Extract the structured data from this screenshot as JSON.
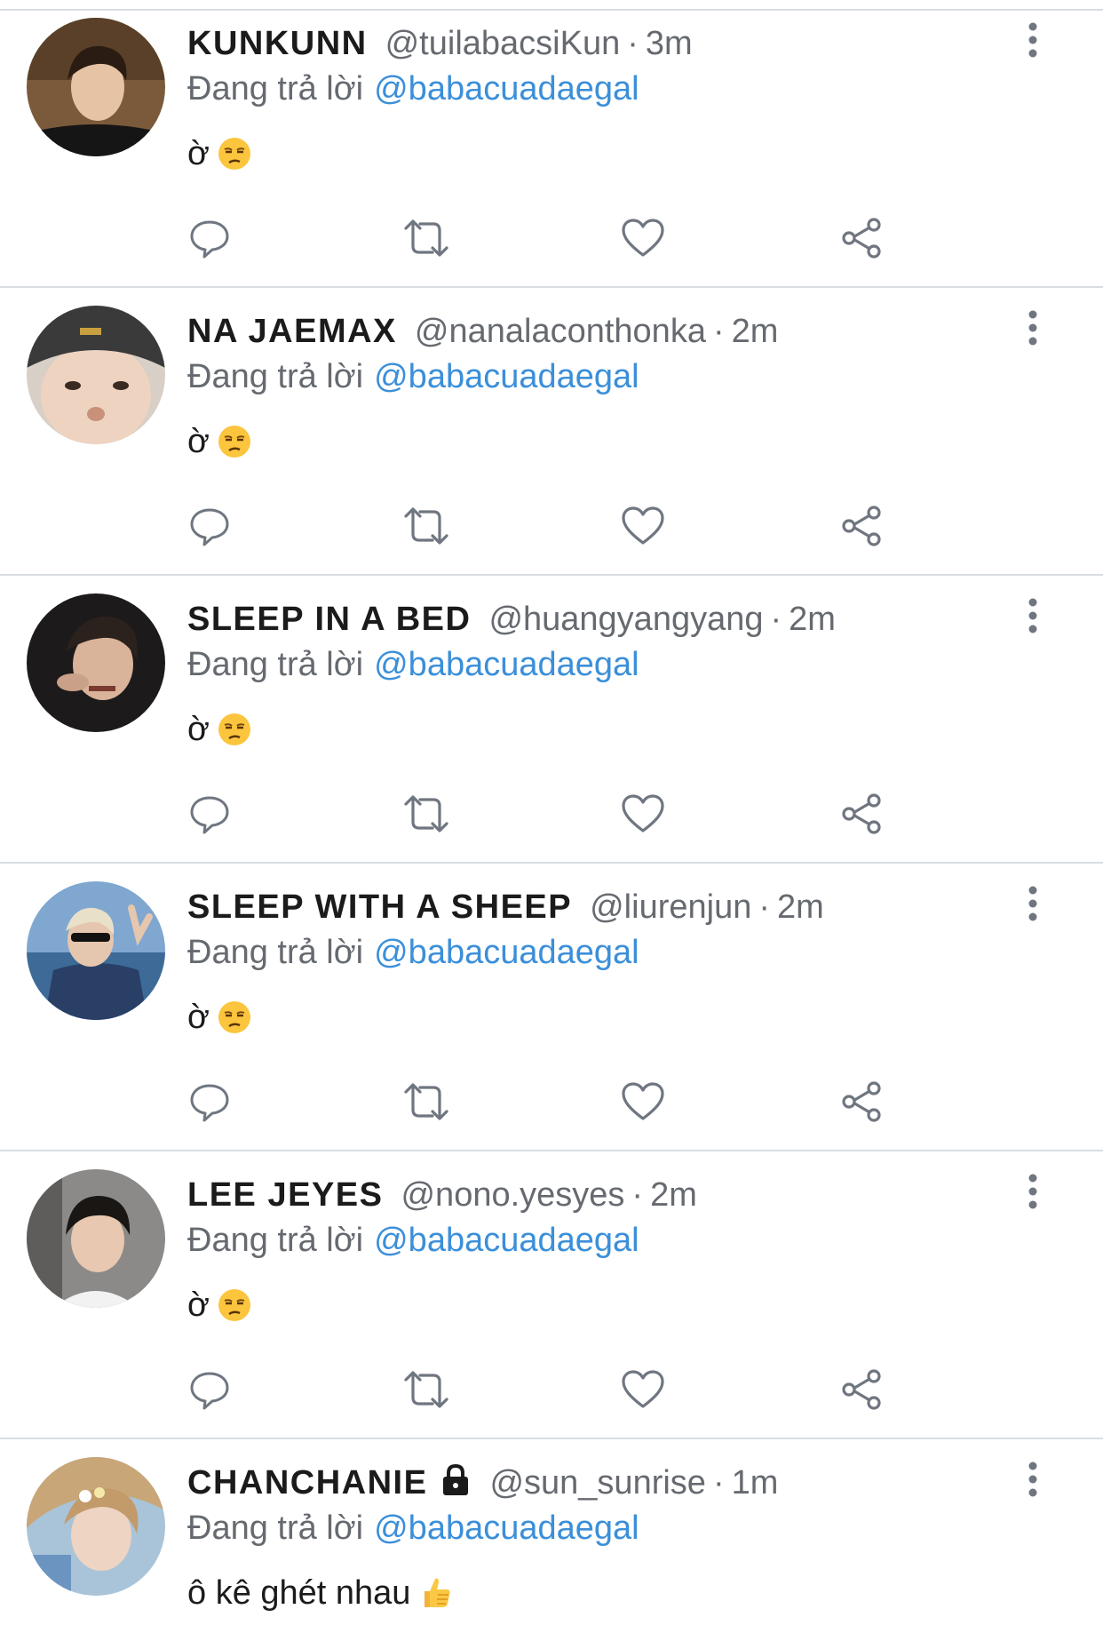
{
  "reply_prefix": "Đang trả lời",
  "colors": {
    "link": "#3b8fd9",
    "secondary_text": "#666a70",
    "divider": "#d9dde2",
    "icon_gray": "#6f7680"
  },
  "icons": {
    "more": "more-vertical-icon",
    "reply": "reply-icon",
    "retweet": "retweet-icon",
    "like": "heart-icon",
    "share": "share-icon",
    "lock": "lock-icon"
  },
  "tweets": [
    {
      "display_name": "KUNKUNN",
      "handle": "@tuilabacsiKun",
      "time": "3m",
      "reply_to": "@babacuadaegal",
      "text": "ờ",
      "emoji": "unamused-face"
    },
    {
      "display_name": "NA JAEMAX",
      "handle": "@nanalaconthonka",
      "time": "2m",
      "reply_to": "@babacuadaegal",
      "text": "ờ",
      "emoji": "unamused-face"
    },
    {
      "display_name": "SLEEP IN A BED",
      "handle": "@huangyangyang",
      "time": "2m",
      "reply_to": "@babacuadaegal",
      "text": "ờ",
      "emoji": "unamused-face"
    },
    {
      "display_name": "SLEEP WITH A SHEEP",
      "handle": "@liurenjun",
      "time": "2m",
      "reply_to": "@babacuadaegal",
      "text": "ờ",
      "emoji": "unamused-face"
    },
    {
      "display_name": "LEE JEYES",
      "handle": "@nono.yesyes",
      "time": "2m",
      "reply_to": "@babacuadaegal",
      "text": "ờ",
      "emoji": "unamused-face"
    },
    {
      "display_name": "CHANCHANIE",
      "handle": "@sun_sunrise",
      "time": "1m",
      "reply_to": "@babacuadaegal",
      "text": "ô kê ghét nhau",
      "emoji": "thumbs-up",
      "locked": true
    }
  ]
}
